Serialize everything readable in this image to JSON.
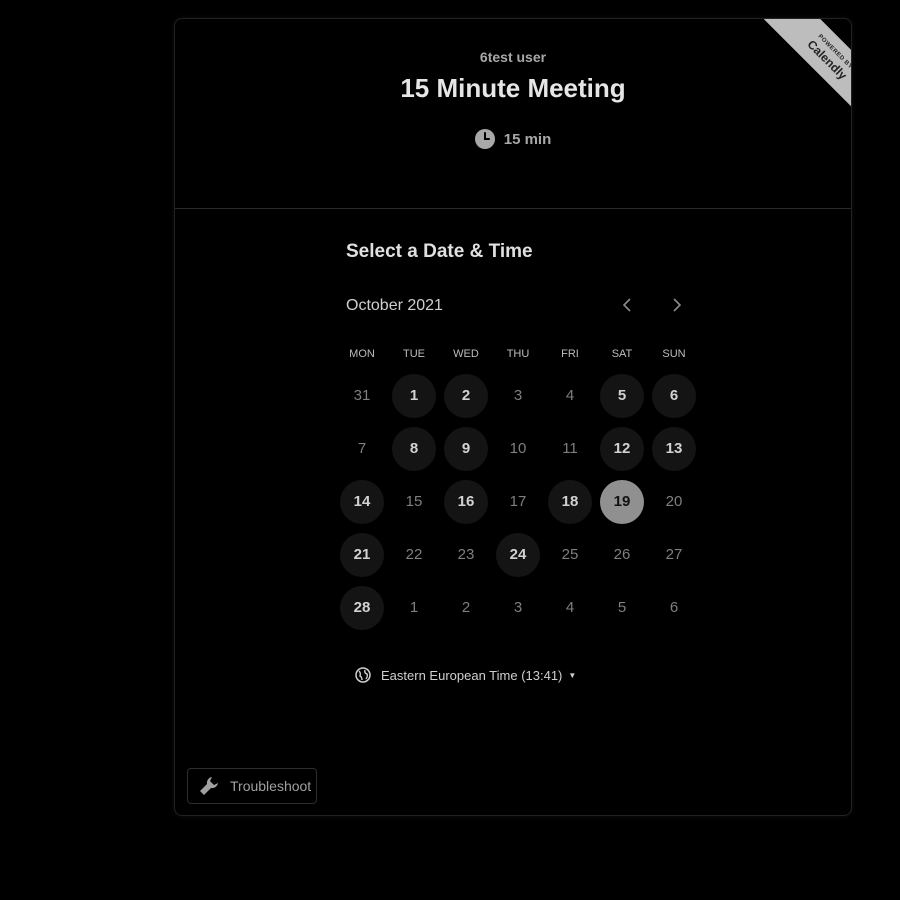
{
  "header": {
    "host_name": "6test user",
    "event_title": "15 Minute Meeting",
    "duration": "15 min",
    "duration_icon": "clock-icon"
  },
  "badge": {
    "powered_by": "POWERED BY",
    "brand": "Calendly"
  },
  "scheduler": {
    "section_title": "Select a Date & Time",
    "month_label": "October 2021",
    "prev_icon": "chevron-left-icon",
    "next_icon": "chevron-right-icon",
    "weekdays": [
      "MON",
      "TUE",
      "WED",
      "THU",
      "FRI",
      "SAT",
      "SUN"
    ],
    "days": [
      {
        "label": "31",
        "state": "disabled"
      },
      {
        "label": "1",
        "state": "available"
      },
      {
        "label": "2",
        "state": "available"
      },
      {
        "label": "3",
        "state": "disabled"
      },
      {
        "label": "4",
        "state": "disabled"
      },
      {
        "label": "5",
        "state": "available"
      },
      {
        "label": "6",
        "state": "available"
      },
      {
        "label": "7",
        "state": "disabled"
      },
      {
        "label": "8",
        "state": "available"
      },
      {
        "label": "9",
        "state": "available"
      },
      {
        "label": "10",
        "state": "disabled"
      },
      {
        "label": "11",
        "state": "disabled"
      },
      {
        "label": "12",
        "state": "available"
      },
      {
        "label": "13",
        "state": "available"
      },
      {
        "label": "14",
        "state": "available"
      },
      {
        "label": "15",
        "state": "disabled"
      },
      {
        "label": "16",
        "state": "available"
      },
      {
        "label": "17",
        "state": "disabled"
      },
      {
        "label": "18",
        "state": "available"
      },
      {
        "label": "19",
        "state": "selected"
      },
      {
        "label": "20",
        "state": "disabled"
      },
      {
        "label": "21",
        "state": "available"
      },
      {
        "label": "22",
        "state": "disabled"
      },
      {
        "label": "23",
        "state": "disabled"
      },
      {
        "label": "24",
        "state": "available"
      },
      {
        "label": "25",
        "state": "disabled"
      },
      {
        "label": "26",
        "state": "disabled"
      },
      {
        "label": "27",
        "state": "disabled"
      },
      {
        "label": "28",
        "state": "available"
      },
      {
        "label": "1",
        "state": "disabled"
      },
      {
        "label": "2",
        "state": "disabled"
      },
      {
        "label": "3",
        "state": "disabled"
      },
      {
        "label": "4",
        "state": "disabled"
      },
      {
        "label": "5",
        "state": "disabled"
      },
      {
        "label": "6",
        "state": "disabled"
      }
    ],
    "timezone_label": "Eastern European Time (13:41)",
    "timezone_icon": "globe-icon"
  },
  "footer": {
    "troubleshoot_label": "Troubleshoot",
    "troubleshoot_icon": "wrench-icon"
  },
  "colors": {
    "background": "#000000",
    "selected_day": "#909090",
    "available_day": "#141414",
    "badge": "#bdbdbd"
  }
}
